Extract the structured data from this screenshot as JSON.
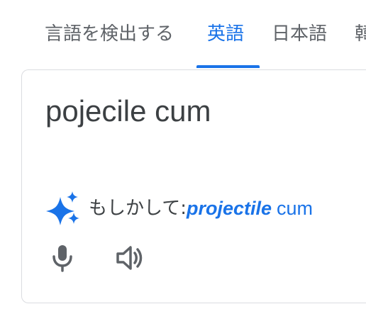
{
  "tabs": [
    {
      "label": "言語を検出する",
      "active": false
    },
    {
      "label": "英語",
      "active": true
    },
    {
      "label": "日本語",
      "active": false
    },
    {
      "label": "韓",
      "active": false
    }
  ],
  "source": {
    "text": "pojecile cum"
  },
  "suggestion": {
    "prefix": "もしかして:",
    "corrected_word": "projectile",
    "rest_text": "cum",
    "icon": "sparkle-icon"
  },
  "toolbar": {
    "microphone_icon": "microphone-icon",
    "speaker_icon": "speaker-icon"
  },
  "colors": {
    "accent": "#1a73e8",
    "text": "#3c4043",
    "muted_text": "#5f6368",
    "border": "#dadce0",
    "background": "#ffffff"
  }
}
